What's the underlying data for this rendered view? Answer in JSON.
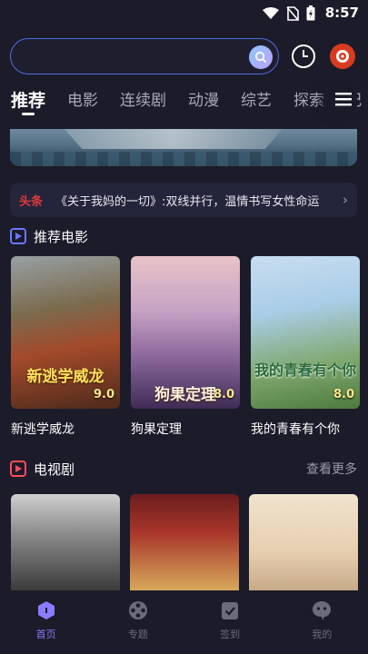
{
  "status_bar": {
    "time": "8:57"
  },
  "search": {
    "placeholder": ""
  },
  "tabs": [
    {
      "label": "推荐",
      "active": true
    },
    {
      "label": "电影"
    },
    {
      "label": "连续剧"
    },
    {
      "label": "动漫"
    },
    {
      "label": "综艺"
    },
    {
      "label": "探索"
    },
    {
      "label": "纪"
    }
  ],
  "news": {
    "tag": "头条",
    "text": "《关于我妈的一切》:双线并行，温情书写女性命运"
  },
  "movies_section": {
    "title": "推荐电影",
    "items": [
      {
        "title": "新逃学威龙",
        "score": "9.0",
        "art_text": "新逃学威龙"
      },
      {
        "title": "狗果定理",
        "score": "8.0",
        "art_text": "狗果定理"
      },
      {
        "title": "我的青春有个你",
        "score": "8.0",
        "art_text": "我的青春有个你"
      }
    ]
  },
  "tv_section": {
    "title": "电视剧",
    "more": "查看更多"
  },
  "bottom_nav": [
    {
      "label": "首页",
      "icon": "home-icon",
      "active": true
    },
    {
      "label": "专题",
      "icon": "film-reel-icon"
    },
    {
      "label": "签到",
      "icon": "checkin-icon"
    },
    {
      "label": "我的",
      "icon": "profile-icon"
    }
  ],
  "colors": {
    "background": "#1b1b29",
    "accent": "#8a7cff",
    "search_border": "#4c6fe0",
    "news_tag": "#e0393e"
  }
}
